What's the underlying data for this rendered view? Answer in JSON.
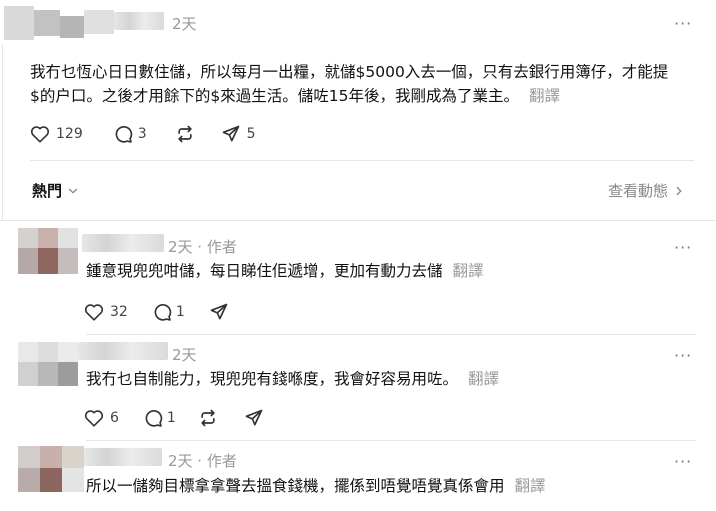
{
  "post": {
    "time": "2天",
    "more": "···",
    "text": "我冇乜恆心日日數住儲，所以每月一出糧，就儲$5000入去一個，只有去銀行用簿仔，才能提$的户口。之後才用餘下的$來過生活。儲咗15年後，我剛成為了業主。",
    "translate": "翻譯",
    "likes": "129",
    "comments": "3",
    "shares": "5"
  },
  "sort": {
    "label": "熱門",
    "activity": "查看動態"
  },
  "replies": [
    {
      "meta": "2天 · 作者",
      "text": "鍾意現兜兜咁儲，每日睇住佢遞增，更加有動力去儲",
      "translate": "翻譯",
      "likes": "32",
      "comments": "1"
    },
    {
      "meta": "2天",
      "text": "我冇乜自制能力，現兜兜有錢喺度，我會好容易用咗。",
      "translate": "翻譯",
      "likes": "6",
      "comments": "1"
    },
    {
      "meta": "2天 · 作者",
      "text": "所以一儲夠目標拿拿聲去搵食錢機，擺係到唔覺唔覺真係會用",
      "translate": "翻譯"
    }
  ],
  "icons": [
    "heart-icon",
    "comment-icon",
    "repost-icon",
    "share-icon",
    "chevron-down-icon",
    "chevron-right-icon",
    "more-icon"
  ]
}
